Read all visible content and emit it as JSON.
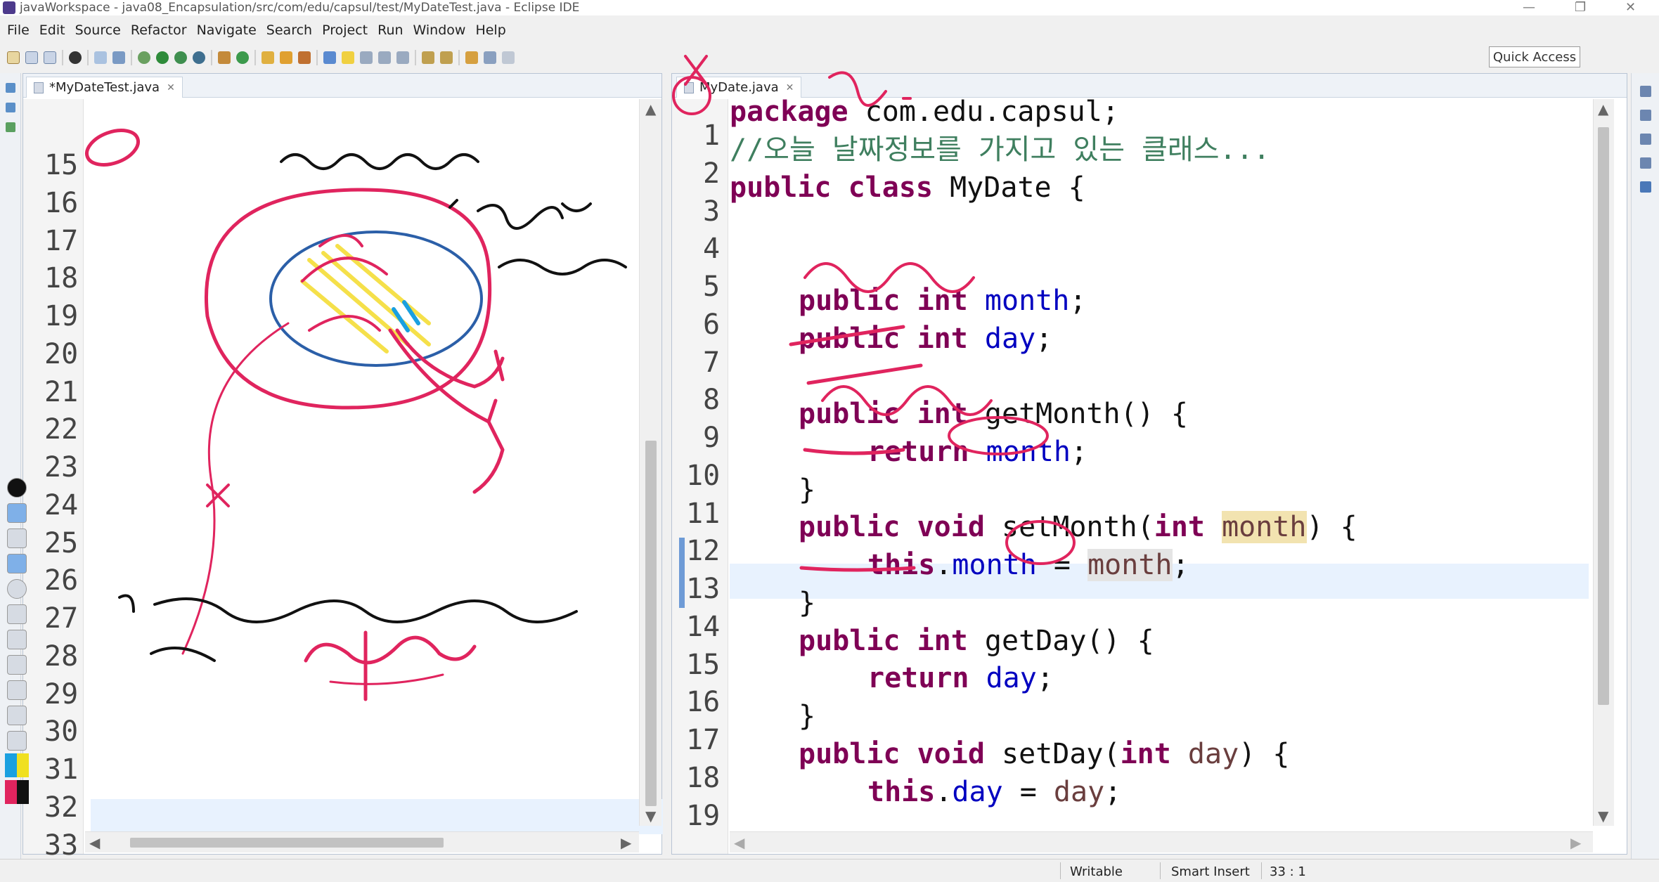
{
  "window": {
    "title": "javaWorkspace - java08_Encapsulation/src/com/edu/capsul/test/MyDateTest.java - Eclipse IDE",
    "minimize": "—",
    "restore": "❐",
    "close": "✕"
  },
  "menu": [
    "File",
    "Edit",
    "Source",
    "Refactor",
    "Navigate",
    "Search",
    "Project",
    "Run",
    "Window",
    "Help"
  ],
  "toolbar": {
    "quick_access": "Quick Access"
  },
  "left_editor": {
    "tab_label": "*MyDateTest.java",
    "line_numbers": [
      "15",
      "16",
      "17",
      "18",
      "19",
      "20",
      "21",
      "22",
      "23",
      "24",
      "25",
      "26",
      "27",
      "28",
      "29",
      "30",
      "31",
      "32",
      "33"
    ]
  },
  "right_editor": {
    "tab_label": "MyDate.java",
    "line_numbers": [
      "1",
      "2",
      "3",
      "4",
      "5",
      "6",
      "7",
      "8",
      "9",
      "10",
      "11",
      "12",
      "13",
      "14",
      "15",
      "16",
      "17",
      "18",
      "19"
    ],
    "code": {
      "l1_kw": "package",
      "l1_rest": " com.edu.capsul;",
      "l2": "//오늘 날짜정보를 가지고 있는 클래스...",
      "l3_kw": "public class",
      "l3_rest": " MyDate {",
      "l6_kw": "public int",
      "l6_fld": "month",
      "l6_end": ";",
      "l7_kw": "public int",
      "l7_fld": "day",
      "l7_end": ";",
      "l9_kw": "public int",
      "l9_rest": " getMonth() {",
      "l10_kw": "return",
      "l10_fld": "month",
      "l10_end": ";",
      "l11": "}",
      "l12_kw": "public void",
      "l12_mid": " setMonth(",
      "l12_kw2": "int",
      "l12_param": "month",
      "l12_end": ") {",
      "l13_kw": "this",
      "l13_dot": ".",
      "l13_fld": "month",
      "l13_eq": " = ",
      "l13_param": "month",
      "l13_end": ";",
      "l14": "}",
      "l15_kw": "public int",
      "l15_rest": " getDay() {",
      "l16_kw": "return",
      "l16_fld": "day",
      "l16_end": ";",
      "l17": "}",
      "l18_kw": "public void",
      "l18_mid": " setDay(",
      "l18_kw2": "int",
      "l18_param": "day",
      "l18_end": ") {",
      "l19_kw": "this",
      "l19_dot": ".",
      "l19_fld": "day",
      "l19_eq": " = ",
      "l19_param": "day",
      "l19_end": ";"
    }
  },
  "status": {
    "writable": "Writable",
    "insert_mode": "Smart Insert",
    "position": "33 : 1"
  },
  "colors": {
    "ink_red": "#e0245e",
    "ink_blue": "#2b5fa8",
    "ink_yellow": "#f5e04a",
    "keyword": "#7f0055",
    "field": "#0000c0",
    "comment": "#3f7f5f"
  }
}
